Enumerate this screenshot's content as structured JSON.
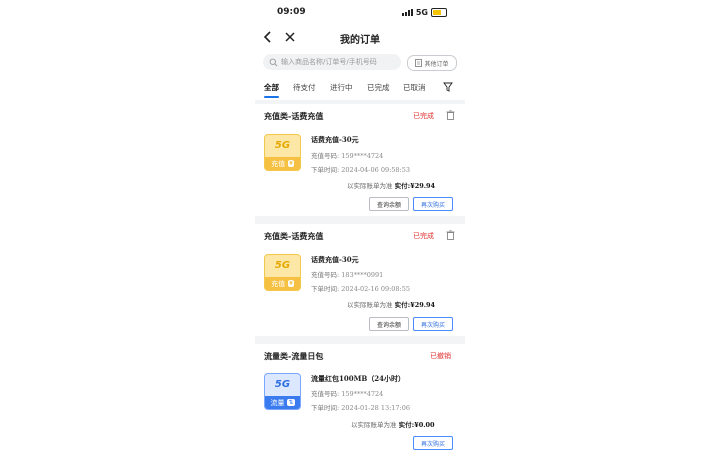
{
  "status": {
    "time": "09:09",
    "network": "5G"
  },
  "header": {
    "title": "我的订单"
  },
  "search": {
    "placeholder": "输入商品名称/订单号/手机号码",
    "other_orders": "其他订单"
  },
  "tabs": [
    "全部",
    "待支付",
    "进行中",
    "已完成",
    "已取消"
  ],
  "orders": [
    {
      "category": "充值类-话费充值",
      "status": "已完成",
      "thumb": {
        "top": "5G",
        "label": "充值",
        "badge": "¥",
        "theme": "yellow"
      },
      "product": "话费充值-30元",
      "phone_label": "充值号码:",
      "phone": "159****4724",
      "time_label": "下单时间:",
      "time": "2024-04-06 09:58:53",
      "note": "以实际账单为准",
      "paid_label": "实付:",
      "paid": "¥29.94",
      "buttons": [
        "查询余额",
        "再次购买"
      ]
    },
    {
      "category": "充值类-话费充值",
      "status": "已完成",
      "thumb": {
        "top": "5G",
        "label": "充值",
        "badge": "¥",
        "theme": "yellow"
      },
      "product": "话费充值-30元",
      "phone_label": "充值号码:",
      "phone": "183****0991",
      "time_label": "下单时间:",
      "time": "2024-02-16 09:08:55",
      "note": "以实际账单为准",
      "paid_label": "实付:",
      "paid": "¥29.94",
      "buttons": [
        "查询余额",
        "再次购买"
      ]
    },
    {
      "category": "流量类-流量日包",
      "status": "已撤销",
      "thumb": {
        "top": "5G",
        "label": "流量",
        "badge": "⇅",
        "theme": "blue"
      },
      "product": "流量红包100MB（24小时）",
      "phone_label": "充值号码:",
      "phone": "159****4724",
      "time_label": "下单时间:",
      "time": "2024-01-28 13:17:06",
      "note": "以实际账单为准",
      "paid_label": "实付:",
      "paid": "¥0.00",
      "buttons": [
        "再次购买"
      ]
    }
  ],
  "colors": {
    "accent": "#1a73e8",
    "status": "#e03131"
  }
}
